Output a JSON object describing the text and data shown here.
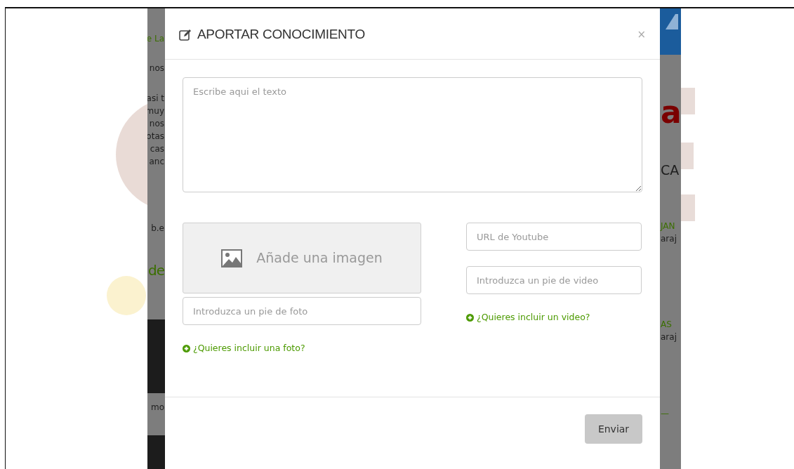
{
  "background_page": {
    "left_fragments": [
      {
        "text": "e La",
        "kind": "link"
      },
      {
        "text": "nos",
        "kind": "text"
      },
      {
        "text": "asi t",
        "kind": "text"
      },
      {
        "text": "muy",
        "kind": "text"
      },
      {
        "text": "nos",
        "kind": "text"
      },
      {
        "text": "otas",
        "kind": "text"
      },
      {
        "text": "cas",
        "kind": "text"
      },
      {
        "text": "anc",
        "kind": "text"
      },
      {
        "text": "b.e",
        "kind": "text"
      },
      {
        "text": "de",
        "kind": "heading"
      },
      {
        "text": "mo",
        "kind": "text"
      }
    ],
    "right_fragments": [
      {
        "text": "a",
        "kind": "brand"
      },
      {
        "text": "CA",
        "kind": "title"
      },
      {
        "text": "JAN",
        "kind": "link"
      },
      {
        "text": "araj",
        "kind": "text"
      },
      {
        "text": "AS",
        "kind": "link"
      },
      {
        "text": "araj",
        "kind": "text"
      },
      {
        "text": "—",
        "kind": "link"
      }
    ]
  },
  "modal": {
    "title": "APORTAR CONOCIMIENTO",
    "close": "×",
    "text_area": {
      "placeholder": "Escribe aqui el texto"
    },
    "image_drop": {
      "label": "Añade una imagen"
    },
    "photo_caption": {
      "placeholder": "Introduzca un pie de foto"
    },
    "add_photo_link": "¿Quieres incluir una foto?",
    "youtube_url": {
      "placeholder": "URL de Youtube"
    },
    "video_caption": {
      "placeholder": "Introduzca un pie de video"
    },
    "add_video_link": "¿Quieres incluir un video?",
    "submit_button": "Enviar"
  }
}
